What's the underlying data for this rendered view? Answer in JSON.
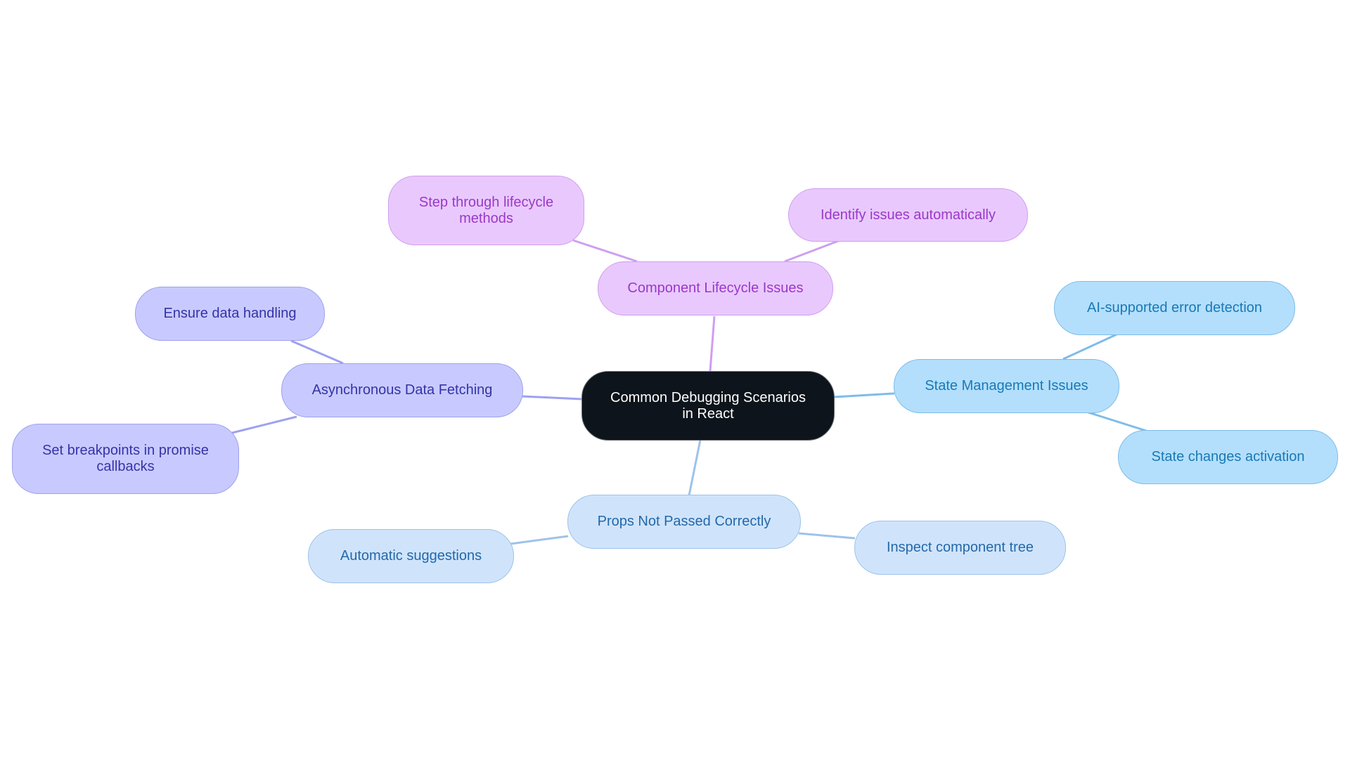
{
  "diagram": {
    "type": "mindmap",
    "root": {
      "id": "root",
      "label": "Common Debugging Scenarios in React",
      "lines": [
        "Common Debugging Scenarios",
        "in React"
      ]
    },
    "branches": [
      {
        "id": "lifecycle",
        "label": "Component Lifecycle Issues",
        "color_group": "purple",
        "children": [
          {
            "id": "lifecycle-step",
            "label": "Step through lifecycle methods",
            "lines": [
              "Step through lifecycle",
              "methods"
            ]
          },
          {
            "id": "lifecycle-identify",
            "label": "Identify issues automatically"
          }
        ]
      },
      {
        "id": "state",
        "label": "State Management Issues",
        "color_group": "sky",
        "children": [
          {
            "id": "state-ai",
            "label": "AI-supported error detection"
          },
          {
            "id": "state-changes",
            "label": "State changes activation"
          }
        ]
      },
      {
        "id": "props",
        "label": "Props Not Passed Correctly",
        "color_group": "pale",
        "children": [
          {
            "id": "props-auto",
            "label": "Automatic suggestions"
          },
          {
            "id": "props-inspect",
            "label": "Inspect component tree"
          }
        ]
      },
      {
        "id": "async",
        "label": "Asynchronous Data Fetching",
        "color_group": "indigo",
        "children": [
          {
            "id": "async-ensure",
            "label": "Ensure data handling"
          },
          {
            "id": "async-breakpoints",
            "label": "Set breakpoints in promise callbacks",
            "lines": [
              "Set breakpoints in promise",
              "callbacks"
            ]
          }
        ]
      }
    ],
    "colors": {
      "root_fill": "#0d141b",
      "purple_fill": "#e9c9fd",
      "purple_text": "#9a38c9",
      "purple_edge": "#cf9ef0",
      "indigo_fill": "#c8caff",
      "indigo_text": "#3533a8",
      "indigo_edge": "#9ea1ef",
      "sky_fill": "#b3dffc",
      "sky_text": "#1a79b5",
      "sky_edge": "#7ebce9",
      "pale_fill": "#cfe4fb",
      "pale_text": "#2468aa",
      "pale_edge": "#9ec2ea"
    }
  }
}
